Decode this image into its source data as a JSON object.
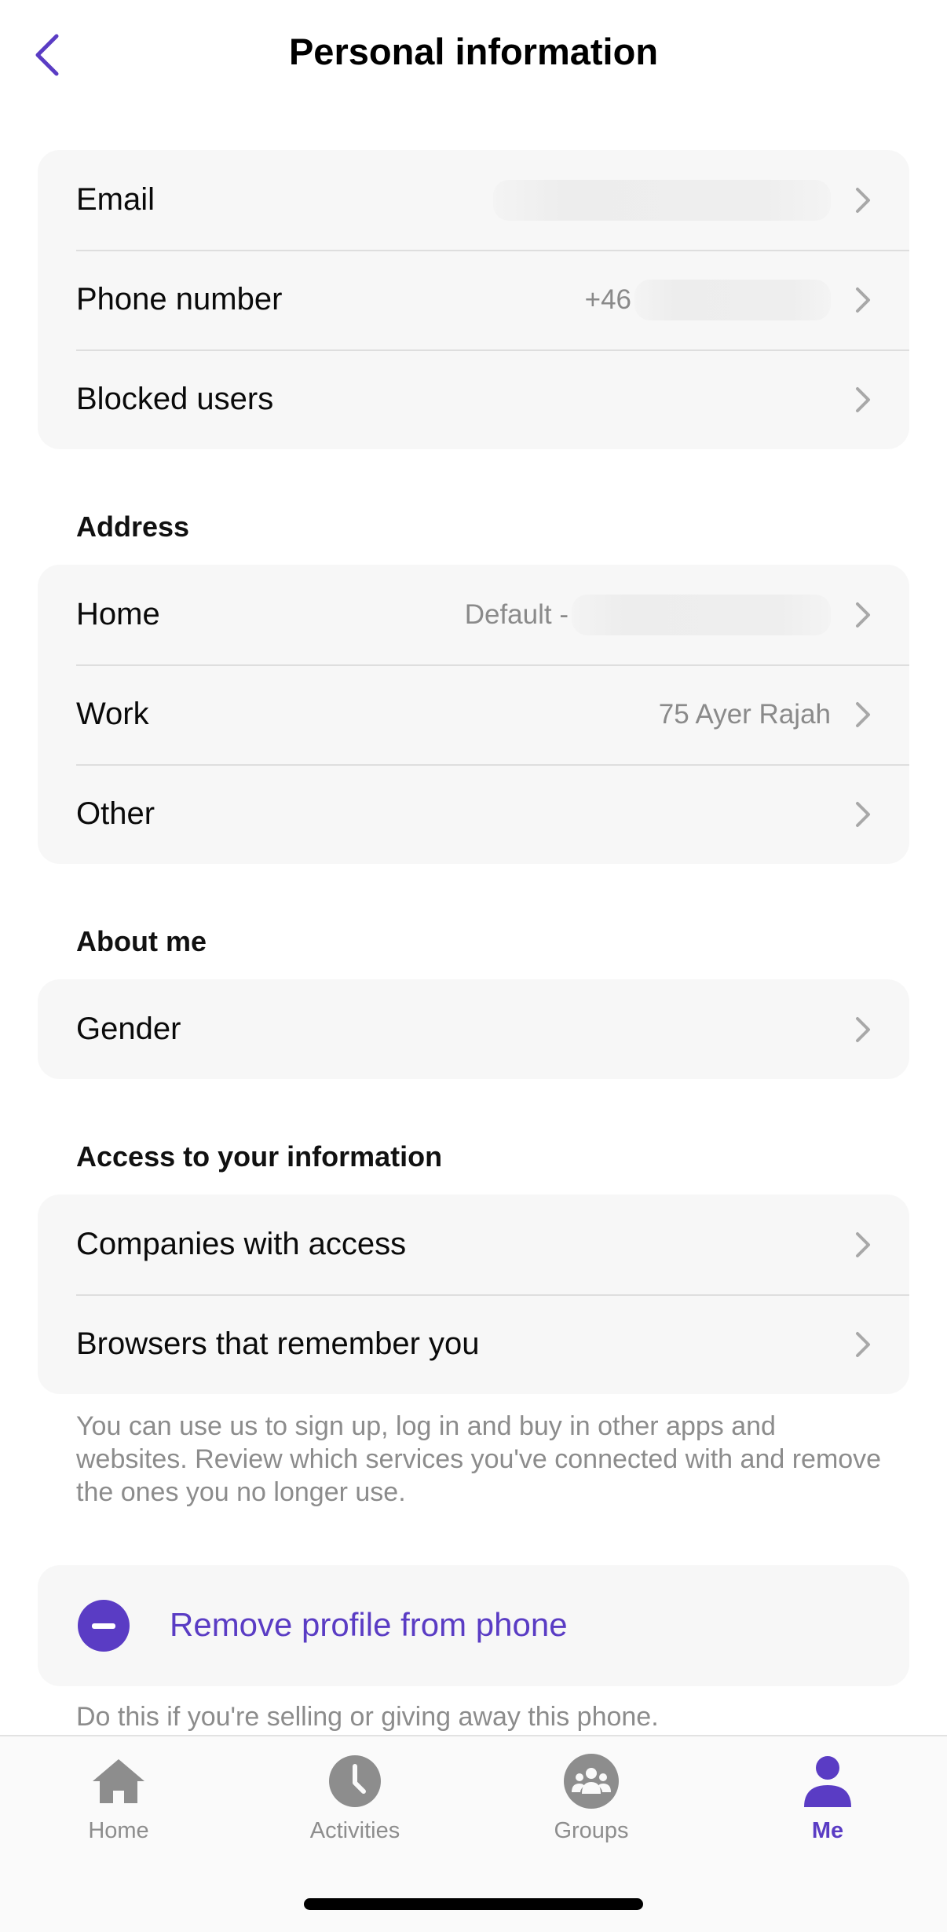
{
  "header": {
    "title": "Personal information"
  },
  "account": {
    "rows": [
      {
        "label": "Email",
        "value": ""
      },
      {
        "label": "Phone number",
        "value": "+46"
      },
      {
        "label": "Blocked users",
        "value": ""
      }
    ]
  },
  "address": {
    "title": "Address",
    "rows": [
      {
        "label": "Home",
        "value": "Default -"
      },
      {
        "label": "Work",
        "value": "75 Ayer Rajah"
      },
      {
        "label": "Other",
        "value": ""
      }
    ]
  },
  "about": {
    "title": "About me",
    "rows": [
      {
        "label": "Gender"
      }
    ]
  },
  "access": {
    "title": "Access to your information",
    "rows": [
      {
        "label": "Companies with access"
      },
      {
        "label": "Browsers that remember you"
      }
    ],
    "hint": "You can use us to sign up, log in and buy in other apps and websites. Review which services you've connected with and remove the ones you no longer use."
  },
  "remove": {
    "label": "Remove profile from phone",
    "hint": "Do this if you're selling or giving away this phone."
  },
  "tabbar": {
    "tabs": [
      {
        "label": "Home",
        "icon": "home-icon"
      },
      {
        "label": "Activities",
        "icon": "clock-icon"
      },
      {
        "label": "Groups",
        "icon": "group-icon"
      },
      {
        "label": "Me",
        "icon": "person-icon",
        "active": true
      }
    ]
  },
  "colors": {
    "accent": "#5a3cc4",
    "card": "#f7f7f7",
    "muted": "#8a8a8a"
  }
}
